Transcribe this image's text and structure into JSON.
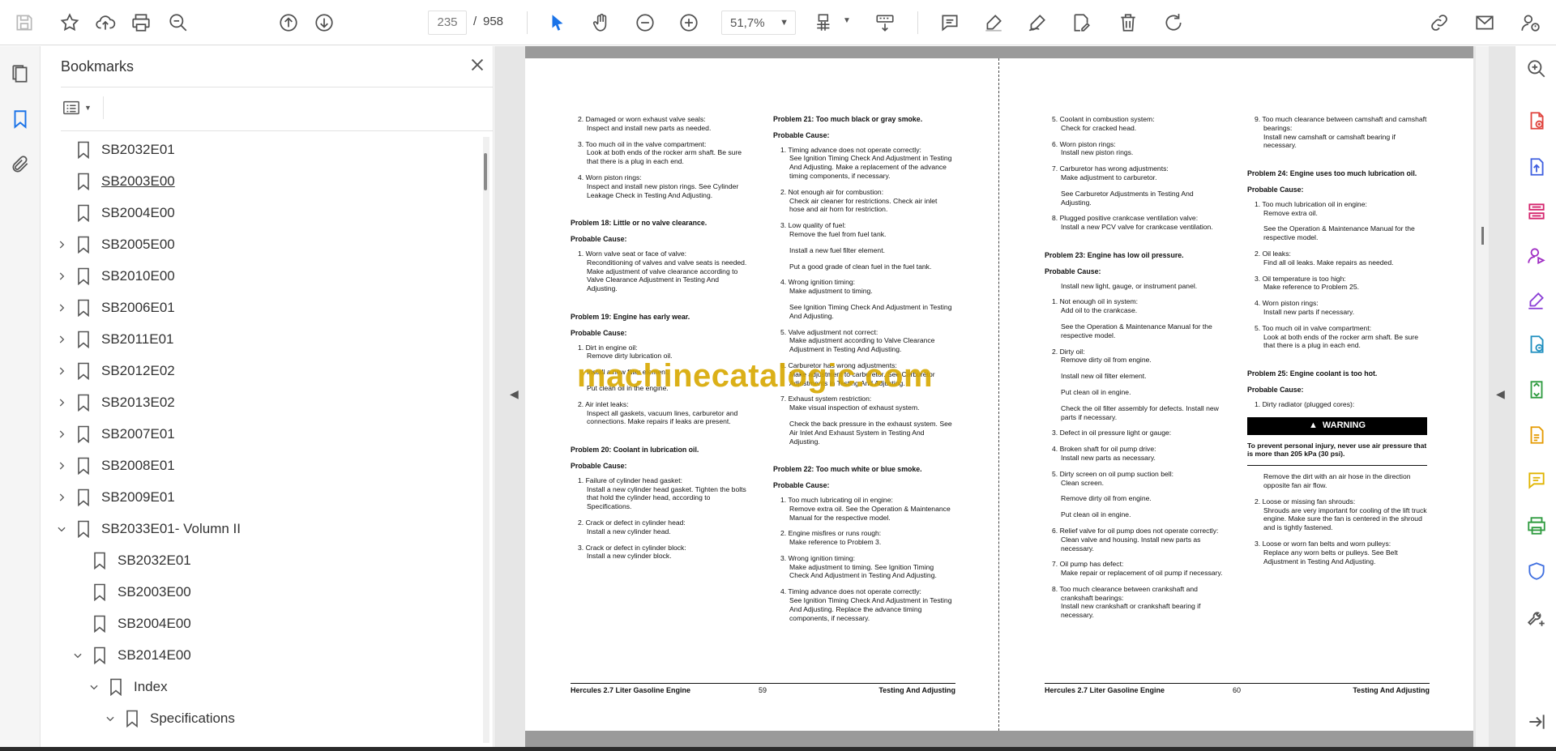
{
  "toolbar": {
    "current_page": "235",
    "page_separator": "/",
    "total_pages": "958",
    "zoom": "51,7%"
  },
  "bookmarks": {
    "title": "Bookmarks",
    "items": [
      {
        "label": "SB2032E01",
        "level": 0,
        "expand": "none",
        "underline": false
      },
      {
        "label": "SB2003E00",
        "level": 0,
        "expand": "none",
        "underline": true
      },
      {
        "label": "SB2004E00",
        "level": 0,
        "expand": "none",
        "underline": false
      },
      {
        "label": "SB2005E00",
        "level": 0,
        "expand": "collapsed",
        "underline": false
      },
      {
        "label": "SB2010E00",
        "level": 0,
        "expand": "collapsed",
        "underline": false
      },
      {
        "label": "SB2006E01",
        "level": 0,
        "expand": "collapsed",
        "underline": false
      },
      {
        "label": "SB2011E01",
        "level": 0,
        "expand": "collapsed",
        "underline": false
      },
      {
        "label": "SB2012E02",
        "level": 0,
        "expand": "collapsed",
        "underline": false
      },
      {
        "label": "SB2013E02",
        "level": 0,
        "expand": "collapsed",
        "underline": false
      },
      {
        "label": "SB2007E01",
        "level": 0,
        "expand": "collapsed",
        "underline": false
      },
      {
        "label": "SB2008E01",
        "level": 0,
        "expand": "collapsed",
        "underline": false
      },
      {
        "label": "SB2009E01",
        "level": 0,
        "expand": "collapsed",
        "underline": false
      },
      {
        "label": "SB2033E01- Volumn II",
        "level": 0,
        "expand": "expanded",
        "underline": false
      },
      {
        "label": "SB2032E01",
        "level": 1,
        "expand": "none",
        "underline": false
      },
      {
        "label": "SB2003E00",
        "level": 1,
        "expand": "none",
        "underline": false
      },
      {
        "label": "SB2004E00",
        "level": 1,
        "expand": "none",
        "underline": false
      },
      {
        "label": "SB2014E00",
        "level": 1,
        "expand": "expanded",
        "underline": false
      },
      {
        "label": "Index",
        "level": 2,
        "expand": "expanded",
        "underline": false
      },
      {
        "label": "Specifications",
        "level": 3,
        "expand": "expanded",
        "underline": false
      }
    ]
  },
  "document": {
    "watermark": "machinecatalogic.com",
    "page59": {
      "footer_left": "Hercules 2.7 Liter Gasoline Engine",
      "footer_page": "59",
      "footer_right": "Testing And Adjusting",
      "col1": {
        "i2_num": "2.",
        "i2": "Damaged or worn exhaust valve seals:",
        "i2_s1": "Inspect and install new parts as needed.",
        "i3_num": "3.",
        "i3": "Too much oil in the valve compartment:",
        "i3_s1": "Look at both ends of the rocker arm shaft. Be sure that there is a plug in each end.",
        "i4_num": "4.",
        "i4": "Worn piston rings:",
        "i4_s1": "Inspect and install new piston rings. See Cylinder Leakage Check in Testing And Adjusting.",
        "p18": "Problem 18: Little or no valve clearance.",
        "pc": "Probable Cause:",
        "p18_i1_num": "1.",
        "p18_i1": "Worn valve seat or face of valve:",
        "p18_i1_s1": "Reconditioning of valves and valve seats is needed. Make adjustment of valve clearance according to Valve Clearance Adjustment in Testing And Adjusting.",
        "p19": "Problem 19: Engine has early wear.",
        "p19_i1_num": "1.",
        "p19_i1": "Dirt in engine oil:",
        "p19_i1_s1": "Remove dirty lubrication oil.",
        "p19_i1_s2": "Install a new filter element.",
        "p19_i1_s3": "Put clean oil in the engine.",
        "p19_i2_num": "2.",
        "p19_i2": "Air inlet leaks:",
        "p19_i2_s1": "Inspect all gaskets, vacuum lines, carburetor and connections. Make repairs if leaks are present.",
        "p20": "Problem 20: Coolant in lubrication oil.",
        "p20_i1_num": "1.",
        "p20_i1": "Failure of cylinder head gasket:",
        "p20_i1_s1": "Install a new cylinder head gasket. Tighten the bolts that hold the cylinder head, according to Specifications.",
        "p20_i2_num": "2.",
        "p20_i2": "Crack or defect in cylinder head:",
        "p20_i2_s1": "Install a new cylinder head.",
        "p20_i3_num": "3.",
        "p20_i3": "Crack or defect in cylinder block:",
        "p20_i3_s1": "Install a new cylinder block."
      },
      "col2": {
        "p21": "Problem 21: Too much black or gray smoke.",
        "pc": "Probable Cause:",
        "i1_num": "1.",
        "i1": "Timing advance does not operate correctly:",
        "i1_s1": "See Ignition Timing Check And Adjustment in Testing And Adjusting. Make a replacement of the advance timing components, if necessary.",
        "i2_num": "2.",
        "i2": "Not enough air for combustion:",
        "i2_s1": "Check air cleaner for restrictions. Check air inlet hose and air horn for restriction.",
        "i3_num": "3.",
        "i3": "Low quality of fuel:",
        "i3_s1": "Remove the fuel from fuel tank.",
        "i3_s2": "Install a new fuel filter element.",
        "i3_s3": "Put a good grade of clean fuel in the fuel tank.",
        "i4_num": "4.",
        "i4": "Wrong ignition timing:",
        "i4_s1": "Make adjustment to timing.",
        "i4_s2": "See Ignition Timing Check And Adjustment in Testing And Adjusting.",
        "i5_num": "5.",
        "i5": "Valve adjustment not correct:",
        "i5_s1": "Make adjustment according to Valve Clearance Adjustment in Testing And Adjusting.",
        "i6_num": "6.",
        "i6": "Carburetor has wrong adjustments:",
        "i6_s1": "Make adjustment to carburetor. See Carburetor Adjustments in Testing And Adjusting.",
        "i7_num": "7.",
        "i7": "Exhaust system restriction:",
        "i7_s1": "Make visual inspection of exhaust system.",
        "i7_s2": "Check the back pressure in the exhaust system. See Air Inlet And Exhaust System in Testing And Adjusting.",
        "p22": "Problem 22: Too much white or blue smoke.",
        "p22_i1_num": "1.",
        "p22_i1": "Too much lubricating oil in engine:",
        "p22_i1_s1": "Remove extra oil. See the Operation & Maintenance Manual for the respective model.",
        "p22_i2_num": "2.",
        "p22_i2": "Engine misfires or runs rough:",
        "p22_i2_s1": "Make reference to Problem 3.",
        "p22_i3_num": "3.",
        "p22_i3": "Wrong ignition timing:",
        "p22_i3_s1": "Make adjustment to timing. See Ignition Timing Check And Adjustment in Testing And Adjusting.",
        "p22_i4_num": "4.",
        "p22_i4": "Timing advance does not operate correctly:",
        "p22_i4_s1": "See Ignition Timing Check And Adjustment in Testing And Adjusting. Replace the advance timing components, if necessary."
      }
    },
    "page60": {
      "footer_left": "Hercules 2.7 Liter Gasoline Engine",
      "footer_page": "60",
      "footer_right": "Testing And Adjusting",
      "col3": {
        "i5_num": "5.",
        "i5": "Coolant in combustion system:",
        "i5_s1": "Check for cracked head.",
        "i6_num": "6.",
        "i6": "Worn piston rings:",
        "i6_s1": "Install new piston rings.",
        "i7_num": "7.",
        "i7": "Carburetor has wrong adjustments:",
        "i7_s1": "Make adjustment to carburetor.",
        "i7_s2": "See Carburetor Adjustments in Testing And Adjusting.",
        "i8_num": "8.",
        "i8": "Plugged positive crankcase ventilation valve:",
        "i8_s1": "Install a new PCV valve for crankcase ventilation.",
        "p23": "Problem 23: Engine has low oil pressure.",
        "pc": "Probable Cause:",
        "p23_intro": "Install new light, gauge, or instrument panel.",
        "p23_i1_num": "1.",
        "p23_i1": "Not enough oil in system:",
        "p23_i1_s1": "Add oil to the crankcase.",
        "p23_i1_s2": "See the Operation & Maintenance Manual for the respective model.",
        "p23_i2_num": "2.",
        "p23_i2": "Dirty oil:",
        "p23_i2_s1": "Remove dirty oil from engine.",
        "p23_i2_s2": "Install new oil filter element.",
        "p23_i2_s3": "Put clean oil in engine.",
        "p23_i2_s4": "Check the oil filter assembly for defects. Install new parts if necessary.",
        "p23_i3_num": "3.",
        "p23_i3": "Defect in oil pressure light or gauge:",
        "p23_i4_num": "4.",
        "p23_i4": "Broken shaft for oil pump drive:",
        "p23_i4_s1": "Install new parts as necessary.",
        "p23_i5_num": "5.",
        "p23_i5": "Dirty screen on oil pump suction bell:",
        "p23_i5_s1": "Clean screen.",
        "p23_i5_s2": "Remove dirty oil from engine.",
        "p23_i5_s3": "Put clean oil in engine.",
        "p23_i6_num": "6.",
        "p23_i6": "Relief valve for oil pump does not operate correctly:",
        "p23_i6_s1": "Clean valve and housing. Install new parts as necessary.",
        "p23_i7_num": "7.",
        "p23_i7": "Oil pump has defect:",
        "p23_i7_s1": "Make repair or replacement of oil pump if necessary.",
        "p23_i8_num": "8.",
        "p23_i8": "Too much clearance between crankshaft and crankshaft bearings:",
        "p23_i8_s1": "Install new crankshaft or crankshaft bearing if necessary."
      },
      "col4": {
        "i9_num": "9.",
        "i9": "Too much clearance between camshaft and camshaft bearings:",
        "i9_s1": "Install new camshaft or camshaft bearing if necessary.",
        "p24": "Problem 24: Engine uses too much lubrication oil.",
        "pc": "Probable Cause:",
        "p24_i1_num": "1.",
        "p24_i1": "Too much lubrication oil in engine:",
        "p24_i1_s1": "Remove extra oil.",
        "p24_i1_s2": "See the Operation & Maintenance Manual for the respective model.",
        "p24_i2_num": "2.",
        "p24_i2": "Oil leaks:",
        "p24_i2_s1": "Find all oil leaks. Make repairs as needed.",
        "p24_i3_num": "3.",
        "p24_i3": "Oil temperature is too high:",
        "p24_i3_s1": "Make reference to Problem 25.",
        "p24_i4_num": "4.",
        "p24_i4": "Worn piston rings:",
        "p24_i4_s1": "Install new parts if necessary.",
        "p24_i5_num": "5.",
        "p24_i5": "Too much oil in valve compartment:",
        "p24_i5_s1": "Look at both ends of the rocker arm shaft. Be sure that there is a plug in each end.",
        "p25": "Problem 25: Engine coolant is too hot.",
        "p25_i1_num": "1.",
        "p25_i1": "Dirty radiator (plugged cores):",
        "warning_label": "WARNING",
        "warning_text": "To prevent personal injury, never use air pressure that is more than 205 kPa (30 psi).",
        "p25_i1_s1": "Remove the dirt with an air hose in the direction opposite fan air flow.",
        "p25_i2_num": "2.",
        "p25_i2": "Loose or missing fan shrouds:",
        "p25_i2_s1": "Shrouds are very important for cooling of the lift truck engine. Make sure the fan is centered in the shroud and is tightly fastened.",
        "p25_i3_num": "3.",
        "p25_i3": "Loose or worn fan belts and worn pulleys:",
        "p25_i3_s1": "Replace any worn belts or pulleys. See Belt Adjustment in Testing And Adjusting."
      }
    }
  },
  "colors": {
    "accent_blue": "#1a73e8",
    "watermark": "#d8a800",
    "right_rail_icons": [
      "#e0443e",
      "#3f5fe0",
      "#d5246d",
      "#a02ec4",
      "#8a3ed6",
      "#1f8fbf",
      "#2e9b3f",
      "#e59a00",
      "#e0b400",
      "#2e9b3f",
      "#3f6fe0",
      "#555555"
    ]
  }
}
